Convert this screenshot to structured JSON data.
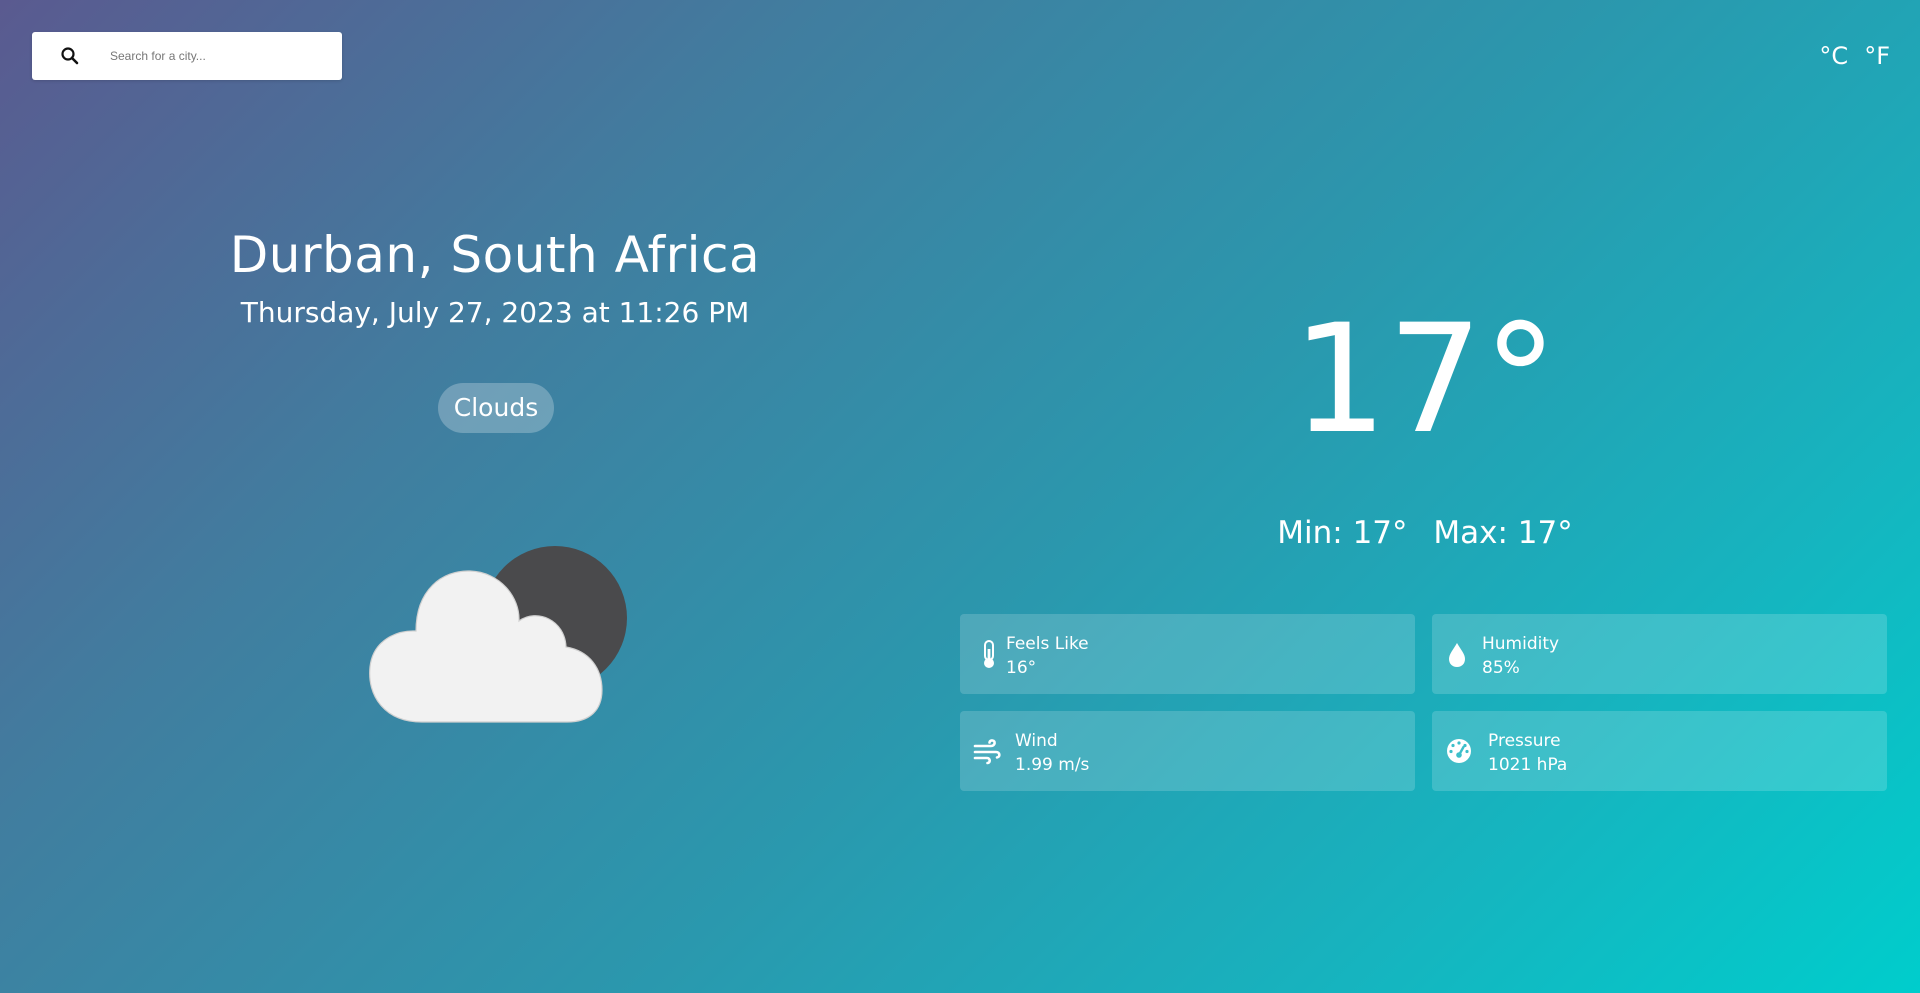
{
  "search": {
    "placeholder": "Search for a city..."
  },
  "units": {
    "celsius_label": "°C",
    "fahrenheit_label": "°F"
  },
  "location": {
    "name": "Durban, South Africa",
    "datetime": "Thursday, July 27, 2023 at 11:26 PM"
  },
  "condition": {
    "label": "Clouds",
    "icon": "partly-cloudy-night-icon"
  },
  "current": {
    "temperature": "17°",
    "min_label": "Min: 17°",
    "max_label": "Max: 17°"
  },
  "stats": {
    "feels_like": {
      "label": "Feels Like",
      "value": "16°",
      "icon": "thermometer-icon"
    },
    "humidity": {
      "label": "Humidity",
      "value": "85%",
      "icon": "droplet-icon"
    },
    "wind": {
      "label": "Wind",
      "value": "1.99 m/s",
      "icon": "wind-icon"
    },
    "pressure": {
      "label": "Pressure",
      "value": "1021 hPa",
      "icon": "gauge-icon"
    }
  },
  "colors": {
    "cloud": "#f2f2f2",
    "moon": "#4a4a4c",
    "text": "#ffffff"
  }
}
